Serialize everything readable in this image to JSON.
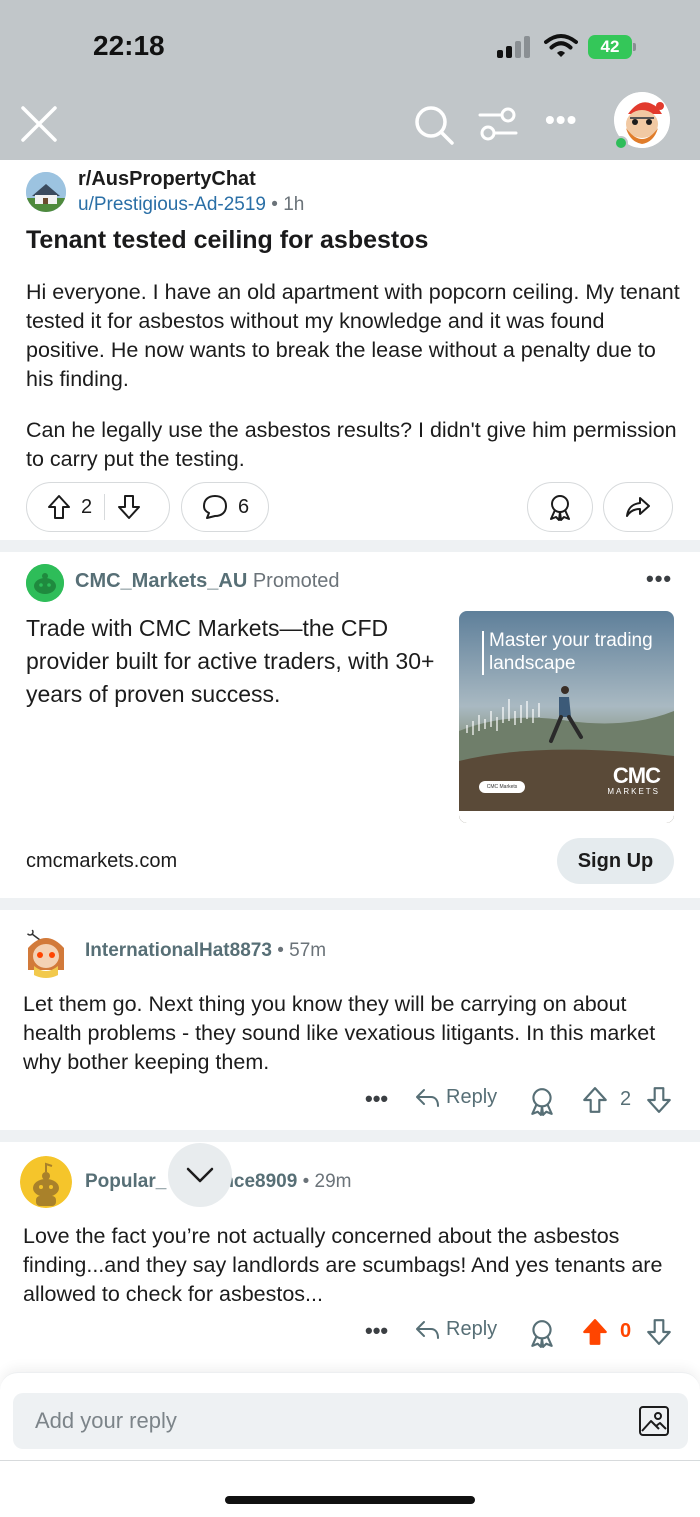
{
  "status_bar": {
    "time": "22:18",
    "battery": "42"
  },
  "header": {
    "close_icon": "close-icon",
    "search_icon": "search-icon",
    "filter_icon": "filter-icon",
    "more_label": "•••"
  },
  "post": {
    "subreddit": "r/AusPropertyChat",
    "author": "u/Prestigious-Ad-2519",
    "separator": "•",
    "age": "1h",
    "title": "Tenant tested ceiling for asbestos",
    "body_p1": "Hi everyone. I have an old apartment with popcorn ceiling. My tenant tested it for asbestos without my knowledge and it was found positive. He now wants to break the lease without a penalty due to his finding.",
    "body_p2": "Can he legally use the asbestos results? I didn't give him permission to carry put the testing.",
    "upvotes": "2",
    "comments": "6"
  },
  "promoted": {
    "advertiser": "CMC_Markets_AU",
    "tag": "Promoted",
    "text": "Trade with CMC Markets—the CFD provider built for active traders, with 30+ years of proven success.",
    "image_headline": "Master your trading landscape",
    "image_logo": "CMC",
    "image_logo_sub": "MARKETS",
    "image_button": "CMC Markets",
    "domain": "cmcmarkets.com",
    "cta": "Sign Up",
    "more": "•••"
  },
  "comments": [
    {
      "author": "InternationalHat8873",
      "time": "57m",
      "body": "Let them go. Next thing you know they will be carrying on about health problems - they sound like vexatious litigants. In this market why bother keeping them.",
      "reply_label": "Reply",
      "score": "2",
      "upvoted": false
    },
    {
      "author": "Popular_",
      "author_tail": "nce8909",
      "time": "29m",
      "body": "Love the fact you’re not actually concerned about the asbestos finding...and they say landlords are scumbags! And yes tenants are allowed to check for asbestos...",
      "reply_label": "Reply",
      "score": "0",
      "upvoted": true
    }
  ],
  "reply_bar": {
    "placeholder": "Add your reply"
  },
  "colors": {
    "header_bg": "#c1c6c9",
    "upvote_active": "#ff4500",
    "link_blue": "#2a6fa6",
    "battery_green": "#34c759"
  }
}
